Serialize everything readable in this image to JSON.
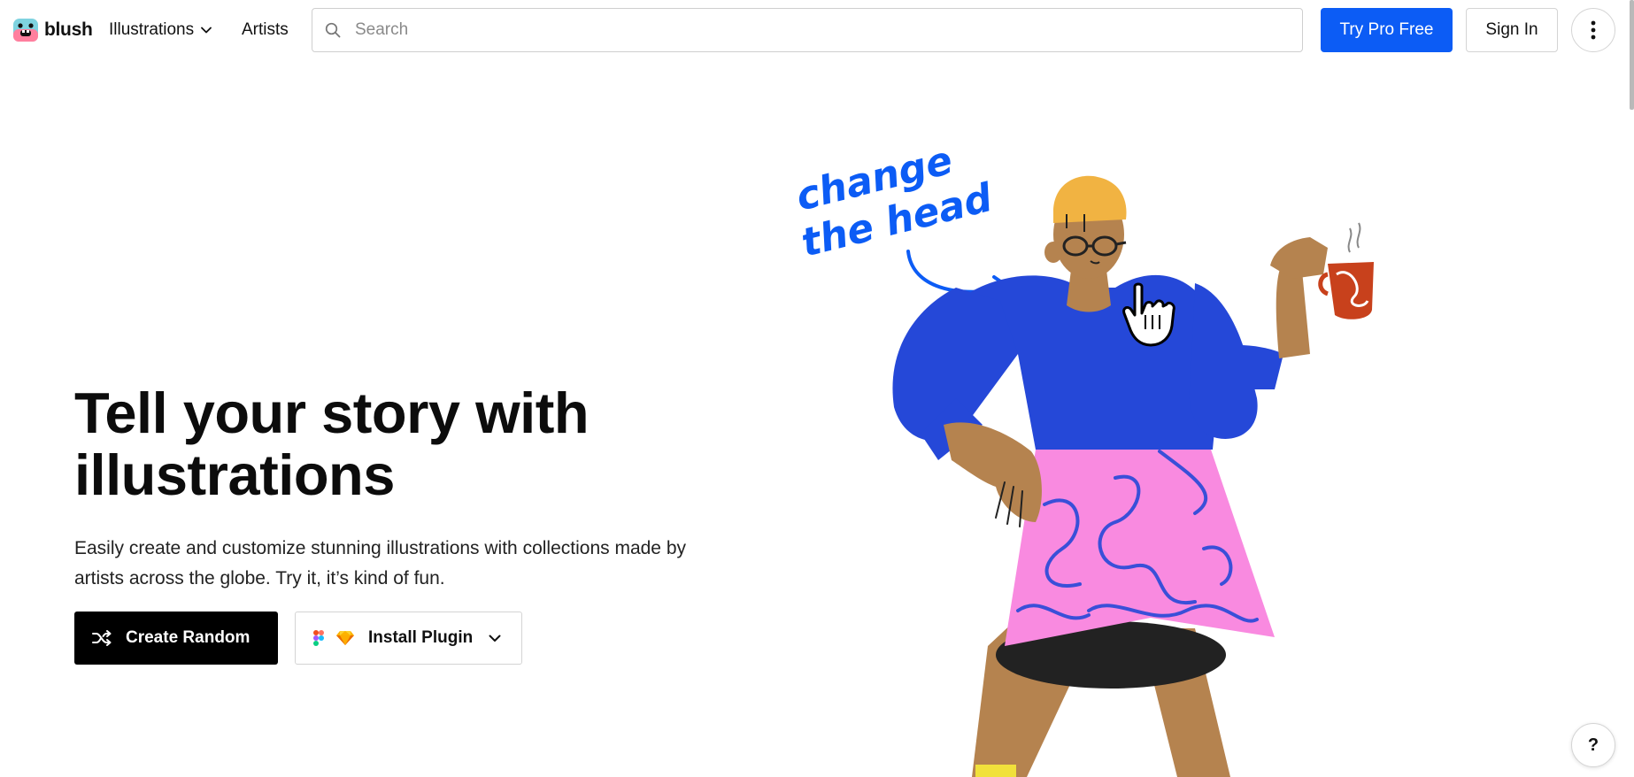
{
  "header": {
    "logo_text": "blush",
    "nav": {
      "illustrations_label": "Illustrations",
      "artists_label": "Artists"
    },
    "search": {
      "placeholder": "Search",
      "value": ""
    },
    "try_pro_label": "Try Pro Free",
    "sign_in_label": "Sign In"
  },
  "hero": {
    "title": "Tell your story with illustrations",
    "description": "Easily create and customize stunning illustrations with collections made by artists across the globe. Try it, it’s kind of fun.",
    "create_random_label": "Create Random",
    "install_plugin_label": "Install Plugin",
    "handwritten_line1": "change",
    "handwritten_line2": "the head"
  },
  "help_label": "?",
  "colors": {
    "primary_blue": "#0c5cf5",
    "black_button": "#000000",
    "sweater_blue": "#2548d8",
    "skirt_pink": "#f98ae0",
    "skin": "#b5834f",
    "hat_yellow": "#f1b342",
    "mug_red": "#c8411c"
  },
  "icons": {
    "logo": "blush-face-icon",
    "search": "search-icon",
    "more": "vertical-dots-icon",
    "shuffle": "shuffle-icon",
    "figma": "figma-icon",
    "sketch": "sketch-icon",
    "cursor": "hand-pointer-icon"
  }
}
